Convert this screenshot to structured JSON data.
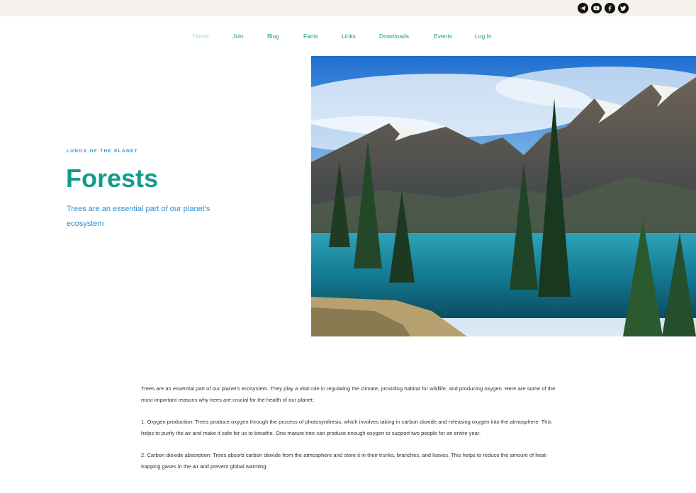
{
  "social": [
    {
      "icon": "telegram-icon"
    },
    {
      "icon": "youtube-icon"
    },
    {
      "icon": "facebook-icon"
    },
    {
      "icon": "twitter-icon"
    }
  ],
  "nav": {
    "items": [
      {
        "label": "Home",
        "active": true
      },
      {
        "label": "Join"
      },
      {
        "label": "Blog"
      },
      {
        "label": "Facts"
      },
      {
        "label": "Links"
      },
      {
        "label": "Downloads"
      },
      {
        "label": "Events"
      },
      {
        "label": "Log In"
      }
    ]
  },
  "hero": {
    "eyebrow": "LUNGS OF THE PLANET",
    "title": "Forests",
    "subtitle": "Trees are an essential part of our planet's ecosystem"
  },
  "content": {
    "paragraphs": [
      "Trees are an essential part of our planet's ecosystem. They play a vital role in regulating the climate, providing habitat for wildlife, and producing oxygen. Here are some of the most important reasons why trees are crucial for the health of our planet:",
      "1. Oxygen production: Trees produce oxygen through the process of photosynthesis, which involves taking in carbon dioxide and releasing oxygen into the atmosphere. This helps to purify the air and make it safe for us to breathe. One mature tree can produce enough oxygen to support two people for an entire year.",
      "2. Carbon dioxide absorption: Trees absorb carbon dioxide from the atmosphere and store it in their trunks, branches, and leaves. This helps to reduce the amount of heat-trapping gases in the air and prevent global warming."
    ]
  },
  "colors": {
    "accent": "#149b8a",
    "link": "#2a8fd1",
    "nav_active": "#9fe0a8",
    "topbar": "#f5f1ec"
  }
}
